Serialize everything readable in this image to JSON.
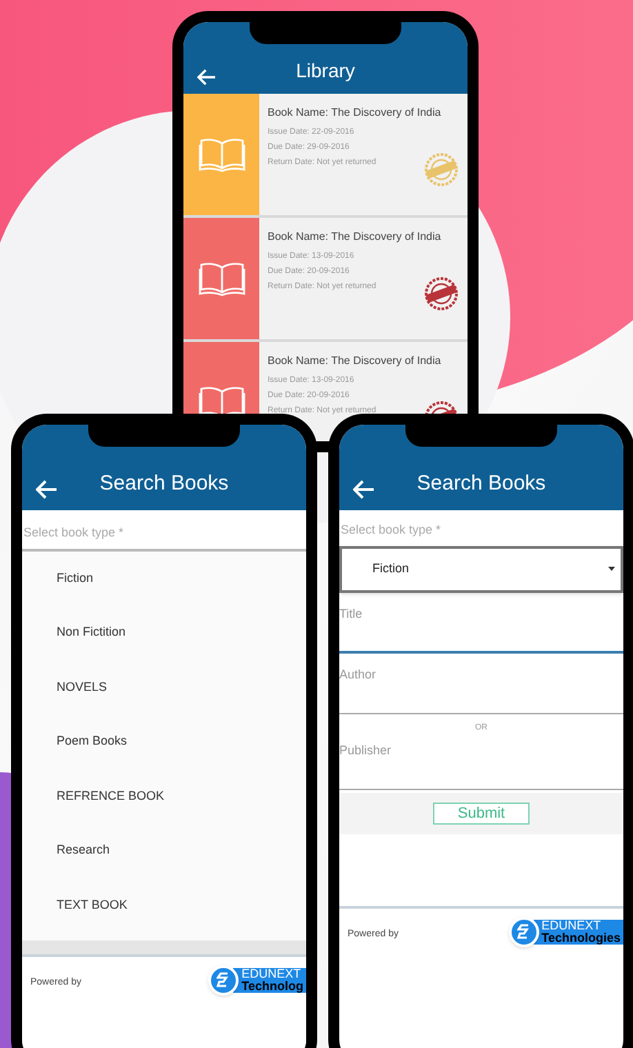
{
  "library": {
    "title": "Library",
    "books": [
      {
        "name": "Book Name: The Discovery of India",
        "issue": "Issue Date: 22-09-2016",
        "due": "Due Date: 29-09-2016",
        "return": "Return Date: Not yet returned",
        "color": "#fbb545",
        "stamp": {
          "color": "#e8c36a"
        }
      },
      {
        "name": "Book Name: The Discovery of India",
        "issue": "Issue Date: 13-09-2016",
        "due": "Due Date: 20-09-2016",
        "return": "Return Date: Not yet returned",
        "color": "#f06b67",
        "stamp": {
          "color": "#b8343a"
        }
      },
      {
        "name": "Book Name: The Discovery of India",
        "issue": "Issue Date: 13-09-2016",
        "due": "Due Date: 20-09-2016",
        "return": "Return Date: Not yet returned",
        "color": "#f06b67",
        "stamp": {
          "color": "#b8343a"
        }
      }
    ]
  },
  "type_list": {
    "title": "Search Books",
    "select_label": "Select book type  *",
    "options": [
      "Fiction",
      "Non Fictition",
      "NOVELS",
      "Poem Books",
      "REFRENCE BOOK",
      "Research",
      "TEXT BOOK"
    ],
    "powered_by": "Powered by",
    "logo": {
      "line1": "EDUNEXT",
      "line2": "Technolog"
    }
  },
  "search_form": {
    "title": "Search Books",
    "select_label": "Select book type  *",
    "selected_type": "Fiction",
    "fields": [
      {
        "placeholder": "Title",
        "focused": true
      },
      {
        "placeholder": "Author",
        "focused": false
      },
      {
        "placeholder": "Publisher",
        "focused": false
      }
    ],
    "or_text": "OR",
    "submit": "Submit",
    "powered_by": "Powered by",
    "logo": {
      "line1": "EDUNEXT",
      "line2": "Technologies"
    }
  }
}
